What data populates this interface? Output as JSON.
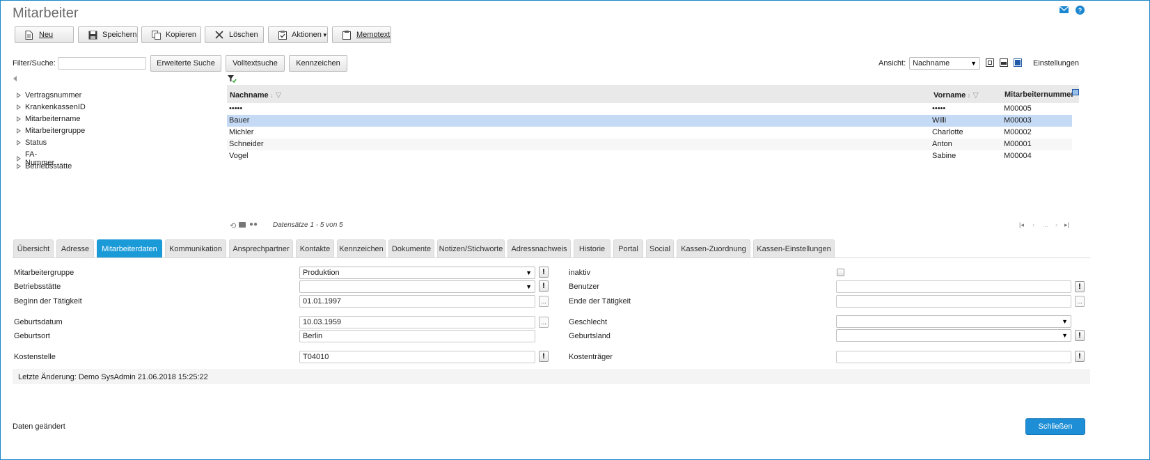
{
  "page": {
    "title": "Mitarbeiter"
  },
  "toolbar": {
    "new_label": "Neu",
    "save_label": "Speichern",
    "copy_label": "Kopieren",
    "delete_label": "Löschen",
    "actions_label": "Aktionen",
    "memo_label": "Memotext"
  },
  "search": {
    "label": "Filter/Suche:",
    "value": "",
    "extended_label": "Erweiterte Suche",
    "fulltext_label": "Volltextsuche",
    "tags_label": "Kennzeichen"
  },
  "view": {
    "label": "Ansicht:",
    "selected": "Nachname",
    "settings_label": "Einstellungen"
  },
  "tree": {
    "items": [
      {
        "label": "Vertragsnummer"
      },
      {
        "label": "KrankenkassenID"
      },
      {
        "label": "Mitarbeitername"
      },
      {
        "label": "Mitarbeitergruppe"
      },
      {
        "label": "Status"
      },
      {
        "label": "FA-Nummer"
      },
      {
        "label": "Betriebsstätte"
      }
    ]
  },
  "grid": {
    "columns": [
      "Nachname",
      "Vorname",
      "Mitarbeiternummer"
    ],
    "rows": [
      {
        "nachname": "•••••",
        "vorname": "•••••",
        "nummer": "M00005"
      },
      {
        "nachname": "Bauer",
        "vorname": "Willi",
        "nummer": "M00003",
        "selected": true
      },
      {
        "nachname": "Michler",
        "vorname": "Charlotte",
        "nummer": "M00002"
      },
      {
        "nachname": "Schneider",
        "vorname": "Anton",
        "nummer": "M00001"
      },
      {
        "nachname": "Vogel",
        "vorname": "Sabine",
        "nummer": "M00004"
      }
    ],
    "records_text": "Datensätze 1 - 5 von 5",
    "pager_ellipsis": "..."
  },
  "tabs": [
    "Übersicht",
    "Adresse",
    "Mitarbeiterdaten",
    "Kommunikation",
    "Ansprechpartner",
    "Kontakte",
    "Kennzeichen",
    "Dokumente",
    "Notizen/Stichworte",
    "Adressnachweis",
    "Historie",
    "Portal",
    "Social",
    "Kassen-Zuordnung",
    "Kassen-Einstellungen"
  ],
  "active_tab": "Mitarbeiterdaten",
  "form": {
    "mitarbeitergruppe_label": "Mitarbeitergruppe",
    "mitarbeitergruppe_value": "Produktion",
    "betriebsstaette_label": "Betriebsstätte",
    "betriebsstaette_value": "",
    "beginn_label": "Beginn der Tätigkeit",
    "beginn_value": "01.01.1997",
    "geburtsdatum_label": "Geburtsdatum",
    "geburtsdatum_value": "10.03.1959",
    "geburtsort_label": "Geburtsort",
    "geburtsort_value": "Berlin",
    "kostenstelle_label": "Kostenstelle",
    "kostenstelle_value": "T04010",
    "inaktiv_label": "inaktiv",
    "inaktiv_checked": false,
    "benutzer_label": "Benutzer",
    "benutzer_value": "",
    "ende_label": "Ende der Tätigkeit",
    "ende_value": "",
    "geschlecht_label": "Geschlecht",
    "geschlecht_value": "",
    "geburtsland_label": "Geburtsland",
    "geburtsland_value": "",
    "kostentraeger_label": "Kostenträger",
    "kostentraeger_value": "",
    "dots_label": "...",
    "excl_label": "!"
  },
  "footer": {
    "last_change": "Letzte Änderung: Demo SysAdmin 21.06.2018 15:25:22",
    "status": "Daten geändert",
    "close_label": "Schließen"
  },
  "colors": {
    "accent": "#1b9ad8",
    "selected_row": "#c4daf5",
    "title": "#6b6b6b"
  }
}
